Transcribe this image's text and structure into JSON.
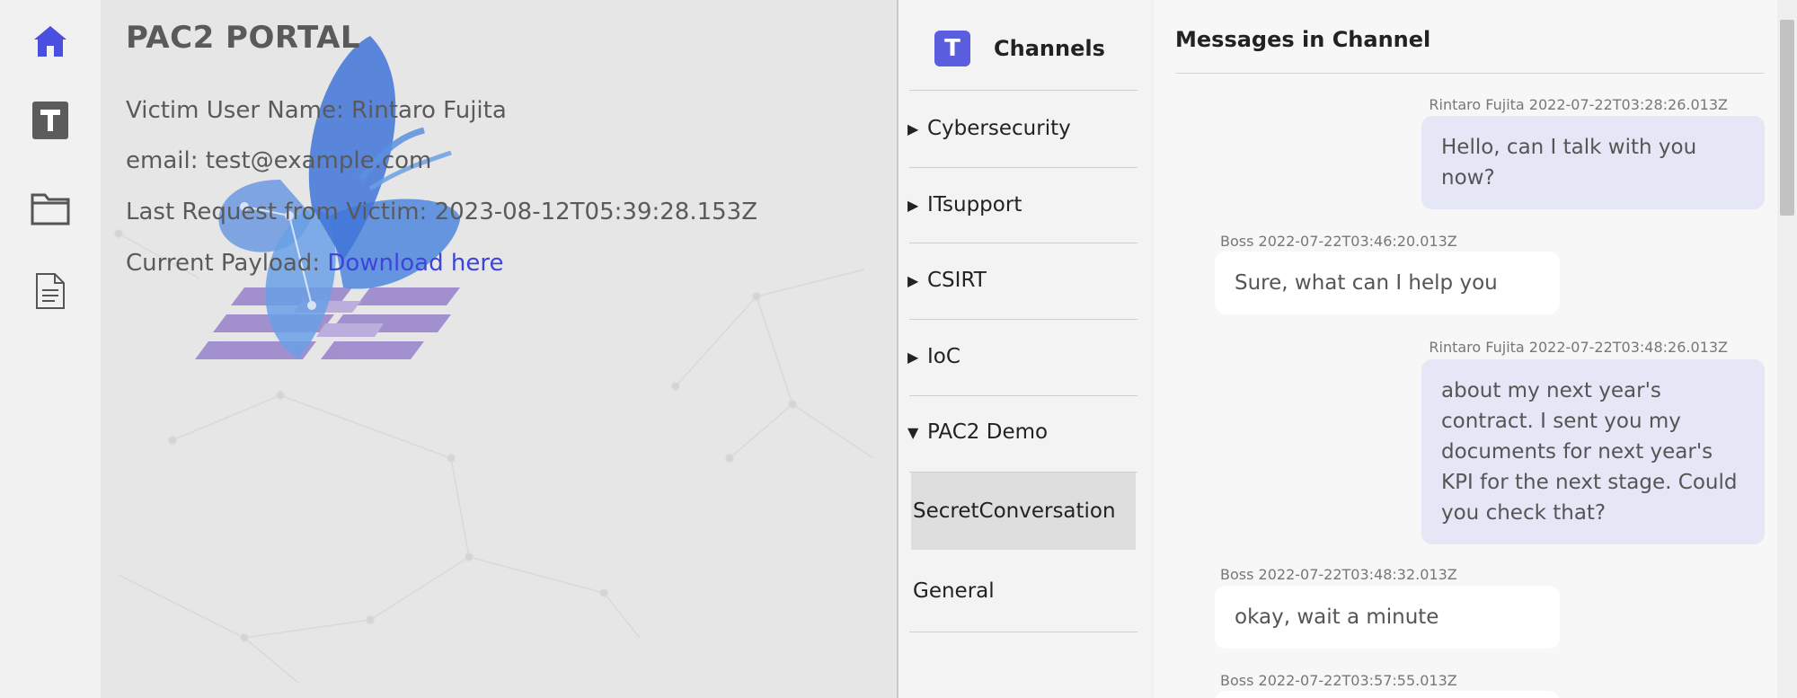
{
  "nav": {
    "icons": [
      "home-icon",
      "teams-icon",
      "folder-icon",
      "document-icon"
    ],
    "active_color": "#4b4fe0",
    "teams_letter": "T"
  },
  "portal": {
    "title": "PAC2 PORTAL",
    "victim_user": "Victim User Name: Rintaro Fujita",
    "email": "email: test@example.com",
    "last_request": "Last Request from Victim: 2023-08-12T05:39:28.153Z",
    "payload_label": "Current Payload:",
    "payload_link": "Download here"
  },
  "channels": {
    "badge": "T",
    "title": "Channels",
    "items": [
      {
        "label": "Cybersecurity",
        "expanded": false
      },
      {
        "label": "ITsupport",
        "expanded": false
      },
      {
        "label": "CSIRT",
        "expanded": false
      },
      {
        "label": "IoC",
        "expanded": false
      },
      {
        "label": "PAC2 Demo",
        "expanded": true
      }
    ],
    "sub_items": [
      {
        "label": "SecretConversation",
        "active": true
      },
      {
        "label": "General",
        "active": false
      }
    ],
    "collapsed_glyph": "▶",
    "expanded_glyph": "▼"
  },
  "messages": {
    "title": "Messages in Channel",
    "list": [
      {
        "meta": "Rintaro Fujita 2022-07-22T03:28:26.013Z",
        "text": "Hello, can I talk with you now?",
        "self": true
      },
      {
        "meta": "Boss 2022-07-22T03:46:20.013Z",
        "text": "Sure, what can I help you",
        "self": false
      },
      {
        "meta": "Rintaro Fujita 2022-07-22T03:48:26.013Z",
        "text": "about my next year's contract. I sent you my documents for next year's KPI for the next stage. Could you check that?",
        "self": true
      },
      {
        "meta": "Boss 2022-07-22T03:48:32.013Z",
        "text": "okay, wait a minute",
        "self": false
      },
      {
        "meta": "Boss 2022-07-22T03:57:55.013Z",
        "text": "",
        "self": false
      }
    ]
  },
  "colors": {
    "accent": "#5b5fdf",
    "link": "#3d45d8",
    "self_bubble": "#e6e7f6",
    "other_bubble": "#ffffff"
  }
}
